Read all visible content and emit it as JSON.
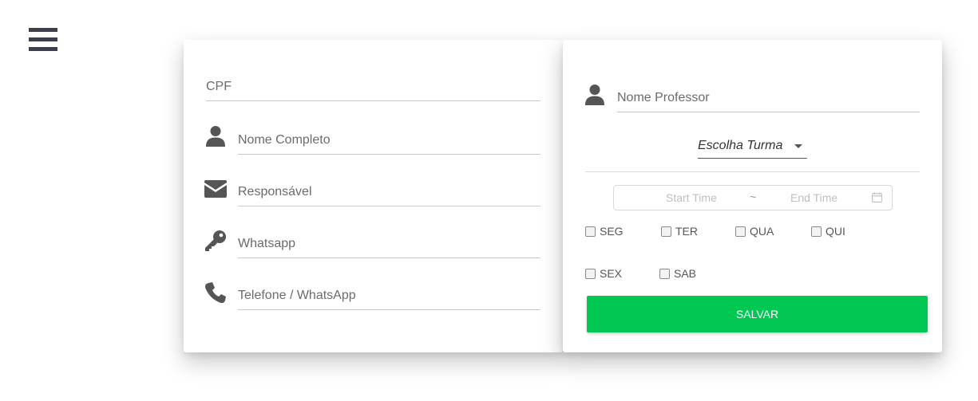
{
  "menu": {
    "icon": "hamburger-menu-icon"
  },
  "student_form": {
    "cpf_placeholder": "CPF",
    "name_placeholder": "Nome Completo",
    "responsible_placeholder": "Responsável",
    "whatsapp_placeholder": "Whatsapp",
    "phone_placeholder": "Telefone / WhatsApp",
    "icons": [
      "user-icon",
      "envelope-icon",
      "key-icon",
      "phone-icon"
    ]
  },
  "class_form": {
    "teacher_placeholder": "Nome Professor",
    "class_select": "Escolha Turma",
    "time_range": {
      "start_placeholder": "Start Time",
      "separator": "~",
      "end_placeholder": "End Time"
    },
    "days": [
      "SEG",
      "TER",
      "QUA",
      "QUI",
      "SEX",
      "SAB"
    ],
    "save_label": "SALVAR"
  },
  "colors": {
    "save_button": "#00c853",
    "icon": "#555555",
    "menu_icon": "#3a3f4b"
  }
}
